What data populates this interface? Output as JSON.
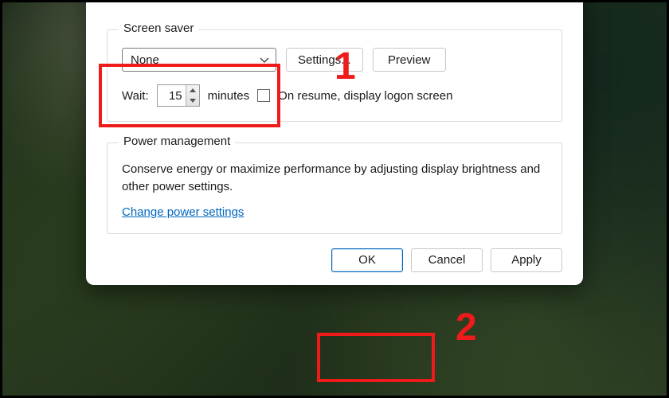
{
  "screensaver": {
    "legend": "Screen saver",
    "combo_value": "None",
    "settings_label": "Settings...",
    "preview_label": "Preview",
    "wait_label": "Wait:",
    "wait_value": "15",
    "minutes_label": "minutes",
    "resume_label": "On resume, display logon screen"
  },
  "power": {
    "legend": "Power management",
    "desc": "Conserve energy or maximize performance by adjusting display brightness and other power settings.",
    "link": "Change power settings"
  },
  "footer": {
    "ok": "OK",
    "cancel": "Cancel",
    "apply": "Apply"
  },
  "annotations": {
    "one": "1",
    "two": "2"
  }
}
